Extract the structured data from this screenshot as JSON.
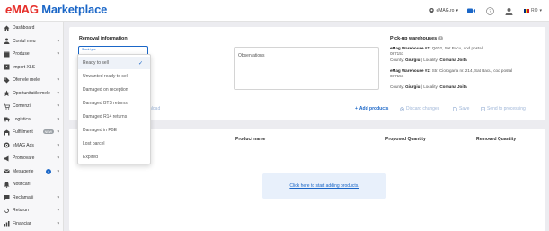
{
  "header": {
    "logo_e": "e",
    "logo_mag": "MAG",
    "logo_marketplace": "Marketplace",
    "store": "eMAG.ro",
    "language": "RO"
  },
  "sidebar": {
    "items": [
      {
        "label": "Dashboard",
        "icon": "home-icon",
        "chevron": ""
      },
      {
        "label": "Contul meu",
        "icon": "user-icon",
        "chevron": "▾"
      },
      {
        "label": "Produse",
        "icon": "box-icon",
        "chevron": "▾"
      },
      {
        "label": "Import XLS",
        "icon": "upload-icon",
        "chevron": ""
      },
      {
        "label": "Ofertele mele",
        "icon": "tag-icon",
        "chevron": "▾"
      },
      {
        "label": "Oportunitatile mele",
        "icon": "star-icon",
        "chevron": "▾"
      },
      {
        "label": "Comenzi",
        "icon": "cart-icon",
        "chevron": "▾"
      },
      {
        "label": "Logistica",
        "icon": "truck-icon",
        "chevron": "▾"
      },
      {
        "label": "Fulfillment",
        "icon": "warehouse-icon",
        "chevron": "▾",
        "badge": "NEW"
      },
      {
        "label": "eMAG Ads",
        "icon": "ads-icon",
        "chevron": "▾"
      },
      {
        "label": "Promovare",
        "icon": "promo-icon",
        "chevron": "▾"
      },
      {
        "label": "Mesagerie",
        "icon": "mail-icon",
        "chevron": "▾",
        "count": "4"
      },
      {
        "label": "Notificari",
        "icon": "bell-icon",
        "chevron": ""
      },
      {
        "label": "Reclamatii",
        "icon": "complaint-icon",
        "chevron": "▾"
      },
      {
        "label": "Returun",
        "icon": "return-icon",
        "chevron": "▾"
      },
      {
        "label": "Financiar",
        "icon": "finance-icon",
        "chevron": "▾"
      }
    ]
  },
  "removal": {
    "title": "Removal information:",
    "stock_type_label": "Stock type",
    "observations_placeholder": "Observations"
  },
  "dropdown": {
    "options": [
      {
        "label": "Ready to sell",
        "selected": true
      },
      {
        "label": "Unwanted ready to sell",
        "selected": false
      },
      {
        "label": "Damaged on reception",
        "selected": false
      },
      {
        "label": "Damaged BTS returns",
        "selected": false
      },
      {
        "label": "Damaged R14 returns",
        "selected": false
      },
      {
        "label": "Damaged in FBE",
        "selected": false
      },
      {
        "label": "Lost parcel",
        "selected": false
      },
      {
        "label": "Expired",
        "selected": false
      }
    ]
  },
  "pickup": {
    "title": "Pick-up warehouses",
    "w1_name": "eMag Warehouse #1:",
    "w1_addr_1": " Q602, Sat Bacu, cod postal",
    "w1_addr_2": "087151",
    "w1_county_label": "County: ",
    "w1_county": "Giurgiu",
    "w1_locality_label": " | Locality: ",
    "w1_locality": "Comuna Joita",
    "w2_name": "eMag Warehouse #2:",
    "w2_addr_1": " Str. Ciorogarla nr. 214, Sat Bacu, cod postal",
    "w2_addr_2": "087151",
    "w2_county_label": "County: ",
    "w2_county": "Giurgiu",
    "w2_locality_label": " | Locality: ",
    "w2_locality": "Comuna Joita"
  },
  "actions": {
    "upload_partial": "nload",
    "add_products": "Add products",
    "discard": "Discard changes",
    "save": "Save",
    "send": "Send to processing"
  },
  "table": {
    "col_product": "Product name",
    "col_proposed": "Proposed Quantity",
    "col_removed": "Removed Quantity",
    "empty_link": "Click here to start adding products."
  },
  "colors": {
    "accent": "#1a66c7",
    "brand_red": "#e6302b"
  }
}
